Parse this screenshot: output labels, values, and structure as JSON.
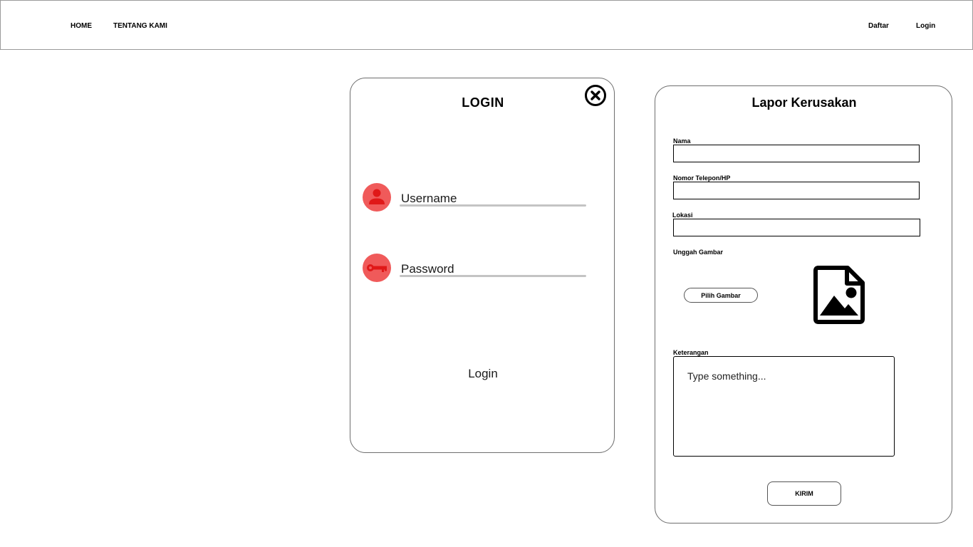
{
  "nav": {
    "home": "HOME",
    "about": "TENTANG KAMI",
    "register": "Daftar",
    "login": "Login"
  },
  "login_card": {
    "title": "LOGIN",
    "username_placeholder": "Username",
    "password_placeholder": "Password",
    "submit_label": "Login",
    "icons": [
      "close-icon",
      "user-icon",
      "key-icon"
    ],
    "accent_color": "#f05a5a"
  },
  "report_card": {
    "title": "Lapor Kerusakan",
    "name_label": "Nama",
    "phone_label": "Nomor Telepon/HP",
    "location_label": "Lokasi",
    "upload_label": "Unggah Gambar",
    "pick_image_label": "Pilih Gambar",
    "image_icon": "image-file-icon",
    "notes_label": "Keterangan",
    "notes_placeholder": "Type something...",
    "submit_label": "KIRIM"
  }
}
